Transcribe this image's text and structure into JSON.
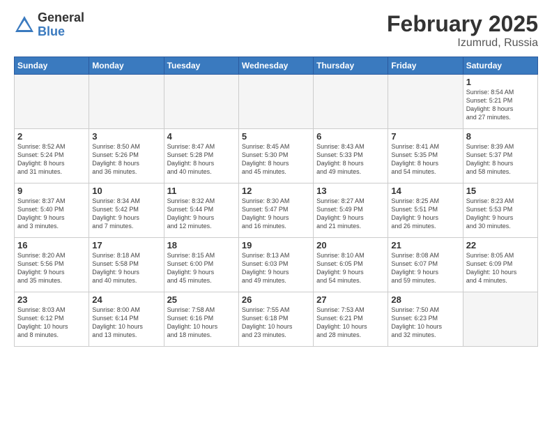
{
  "header": {
    "logo_general": "General",
    "logo_blue": "Blue",
    "title": "February 2025",
    "subtitle": "Izumrud, Russia"
  },
  "days_of_week": [
    "Sunday",
    "Monday",
    "Tuesday",
    "Wednesday",
    "Thursday",
    "Friday",
    "Saturday"
  ],
  "weeks": [
    [
      {
        "day": "",
        "info": ""
      },
      {
        "day": "",
        "info": ""
      },
      {
        "day": "",
        "info": ""
      },
      {
        "day": "",
        "info": ""
      },
      {
        "day": "",
        "info": ""
      },
      {
        "day": "",
        "info": ""
      },
      {
        "day": "1",
        "info": "Sunrise: 8:54 AM\nSunset: 5:21 PM\nDaylight: 8 hours\nand 27 minutes."
      }
    ],
    [
      {
        "day": "2",
        "info": "Sunrise: 8:52 AM\nSunset: 5:24 PM\nDaylight: 8 hours\nand 31 minutes."
      },
      {
        "day": "3",
        "info": "Sunrise: 8:50 AM\nSunset: 5:26 PM\nDaylight: 8 hours\nand 36 minutes."
      },
      {
        "day": "4",
        "info": "Sunrise: 8:47 AM\nSunset: 5:28 PM\nDaylight: 8 hours\nand 40 minutes."
      },
      {
        "day": "5",
        "info": "Sunrise: 8:45 AM\nSunset: 5:30 PM\nDaylight: 8 hours\nand 45 minutes."
      },
      {
        "day": "6",
        "info": "Sunrise: 8:43 AM\nSunset: 5:33 PM\nDaylight: 8 hours\nand 49 minutes."
      },
      {
        "day": "7",
        "info": "Sunrise: 8:41 AM\nSunset: 5:35 PM\nDaylight: 8 hours\nand 54 minutes."
      },
      {
        "day": "8",
        "info": "Sunrise: 8:39 AM\nSunset: 5:37 PM\nDaylight: 8 hours\nand 58 minutes."
      }
    ],
    [
      {
        "day": "9",
        "info": "Sunrise: 8:37 AM\nSunset: 5:40 PM\nDaylight: 9 hours\nand 3 minutes."
      },
      {
        "day": "10",
        "info": "Sunrise: 8:34 AM\nSunset: 5:42 PM\nDaylight: 9 hours\nand 7 minutes."
      },
      {
        "day": "11",
        "info": "Sunrise: 8:32 AM\nSunset: 5:44 PM\nDaylight: 9 hours\nand 12 minutes."
      },
      {
        "day": "12",
        "info": "Sunrise: 8:30 AM\nSunset: 5:47 PM\nDaylight: 9 hours\nand 16 minutes."
      },
      {
        "day": "13",
        "info": "Sunrise: 8:27 AM\nSunset: 5:49 PM\nDaylight: 9 hours\nand 21 minutes."
      },
      {
        "day": "14",
        "info": "Sunrise: 8:25 AM\nSunset: 5:51 PM\nDaylight: 9 hours\nand 26 minutes."
      },
      {
        "day": "15",
        "info": "Sunrise: 8:23 AM\nSunset: 5:53 PM\nDaylight: 9 hours\nand 30 minutes."
      }
    ],
    [
      {
        "day": "16",
        "info": "Sunrise: 8:20 AM\nSunset: 5:56 PM\nDaylight: 9 hours\nand 35 minutes."
      },
      {
        "day": "17",
        "info": "Sunrise: 8:18 AM\nSunset: 5:58 PM\nDaylight: 9 hours\nand 40 minutes."
      },
      {
        "day": "18",
        "info": "Sunrise: 8:15 AM\nSunset: 6:00 PM\nDaylight: 9 hours\nand 45 minutes."
      },
      {
        "day": "19",
        "info": "Sunrise: 8:13 AM\nSunset: 6:03 PM\nDaylight: 9 hours\nand 49 minutes."
      },
      {
        "day": "20",
        "info": "Sunrise: 8:10 AM\nSunset: 6:05 PM\nDaylight: 9 hours\nand 54 minutes."
      },
      {
        "day": "21",
        "info": "Sunrise: 8:08 AM\nSunset: 6:07 PM\nDaylight: 9 hours\nand 59 minutes."
      },
      {
        "day": "22",
        "info": "Sunrise: 8:05 AM\nSunset: 6:09 PM\nDaylight: 10 hours\nand 4 minutes."
      }
    ],
    [
      {
        "day": "23",
        "info": "Sunrise: 8:03 AM\nSunset: 6:12 PM\nDaylight: 10 hours\nand 8 minutes."
      },
      {
        "day": "24",
        "info": "Sunrise: 8:00 AM\nSunset: 6:14 PM\nDaylight: 10 hours\nand 13 minutes."
      },
      {
        "day": "25",
        "info": "Sunrise: 7:58 AM\nSunset: 6:16 PM\nDaylight: 10 hours\nand 18 minutes."
      },
      {
        "day": "26",
        "info": "Sunrise: 7:55 AM\nSunset: 6:18 PM\nDaylight: 10 hours\nand 23 minutes."
      },
      {
        "day": "27",
        "info": "Sunrise: 7:53 AM\nSunset: 6:21 PM\nDaylight: 10 hours\nand 28 minutes."
      },
      {
        "day": "28",
        "info": "Sunrise: 7:50 AM\nSunset: 6:23 PM\nDaylight: 10 hours\nand 32 minutes."
      },
      {
        "day": "",
        "info": ""
      }
    ]
  ]
}
